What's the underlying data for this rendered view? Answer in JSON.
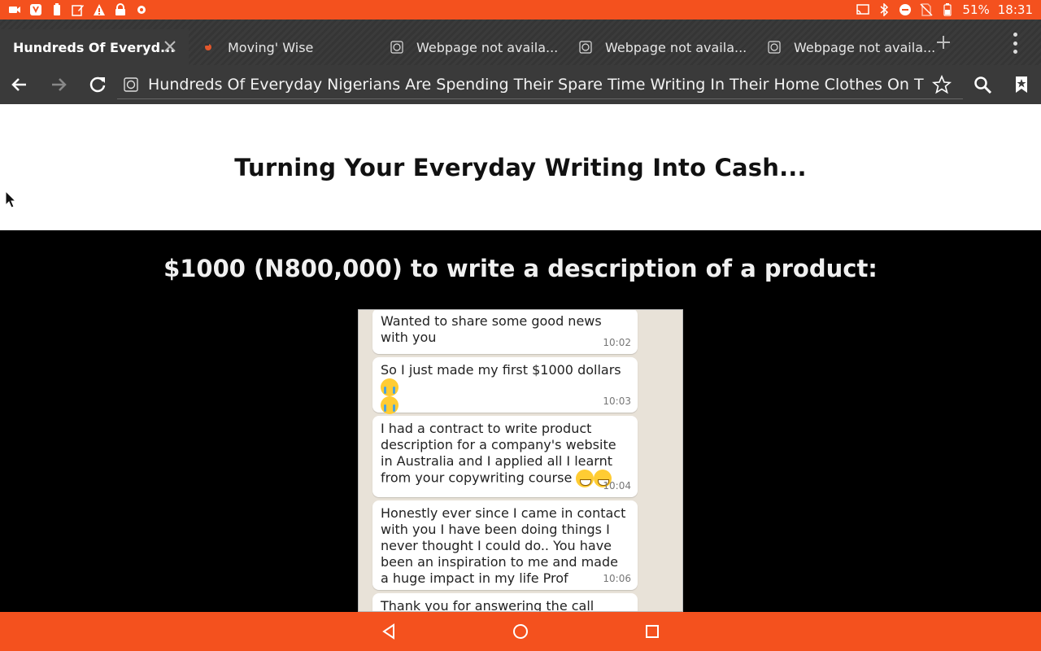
{
  "status_bar": {
    "battery": "51%",
    "time": "18:31"
  },
  "tabs": [
    {
      "title": "Hundreds Of Everyd...",
      "active": true
    },
    {
      "title": "Moving' Wise",
      "active": false
    },
    {
      "title": "Webpage not availa...",
      "active": false
    },
    {
      "title": "Webpage not availa...",
      "active": false
    },
    {
      "title": "Webpage not availa...",
      "active": false
    }
  ],
  "address_bar": {
    "url": "Hundreds Of Everyday Nigerians Are Spending Their Spare Time Writing In Their Home Clothes On Thei"
  },
  "page": {
    "headline": "Turning Your Everyday Writing Into Cash...",
    "subheading": "$1000 (N800,000) to write a description of a product:",
    "chat": [
      {
        "text": "Wanted to share some good news with you",
        "time": "10:02"
      },
      {
        "text": "So I just made my first $1000 dollars",
        "time": "10:03"
      },
      {
        "text": "I had a contract to write product description for a company's website in Australia and I applied all I learnt from your copywriting course",
        "time": "10:04"
      },
      {
        "text": "Honestly ever since I came in contact with you I have been doing things I never thought I could do.. You have been an inspiration to me and made a huge impact in my life Prof",
        "time": "10:06"
      },
      {
        "text": "Thank you for answering the call",
        "time": ""
      }
    ]
  },
  "colors": {
    "accent": "#f4511e",
    "toolbar": "#3a3a3a"
  }
}
